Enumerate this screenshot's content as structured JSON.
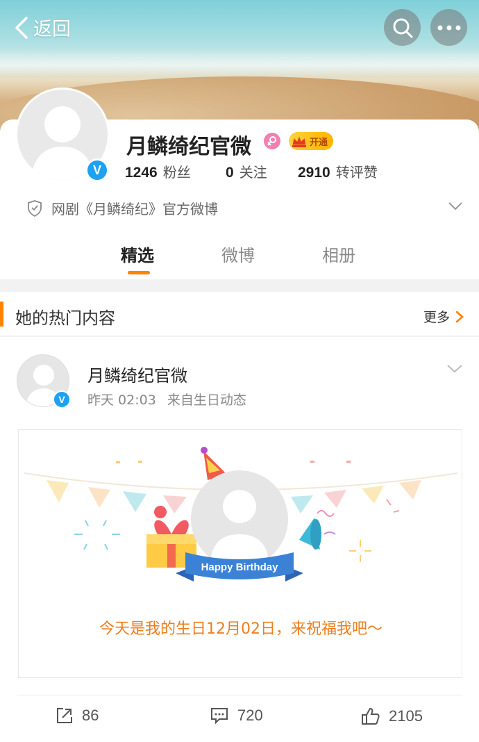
{
  "nav": {
    "back_label": "返回"
  },
  "profile": {
    "name": "月鳞绮纪官微",
    "vip_label": "开通",
    "stats": [
      {
        "value": "1246",
        "label": "粉丝"
      },
      {
        "value": "0",
        "label": "关注"
      },
      {
        "value": "2910",
        "label": "转评赞"
      }
    ],
    "verification": "网剧《月鳞绮纪》官方微博"
  },
  "tabs": [
    {
      "label": "精选",
      "active": true
    },
    {
      "label": "微博",
      "active": false
    },
    {
      "label": "相册",
      "active": false
    }
  ],
  "hot_section": {
    "title": "她的热门内容",
    "more_label": "更多"
  },
  "post": {
    "author": "月鳞绮纪官微",
    "time": "昨天 02:03",
    "source": "来自生日动态",
    "card_ribbon": "Happy Birthday",
    "card_text": "今天是我的生日12月02日，来祝福我吧～",
    "actions": {
      "reposts": "86",
      "comments": "720",
      "likes": "2105"
    }
  },
  "colors": {
    "accent": "#ff8200",
    "verified_blue": "#1da1f2",
    "birthday_orange": "#ef7d1a"
  }
}
